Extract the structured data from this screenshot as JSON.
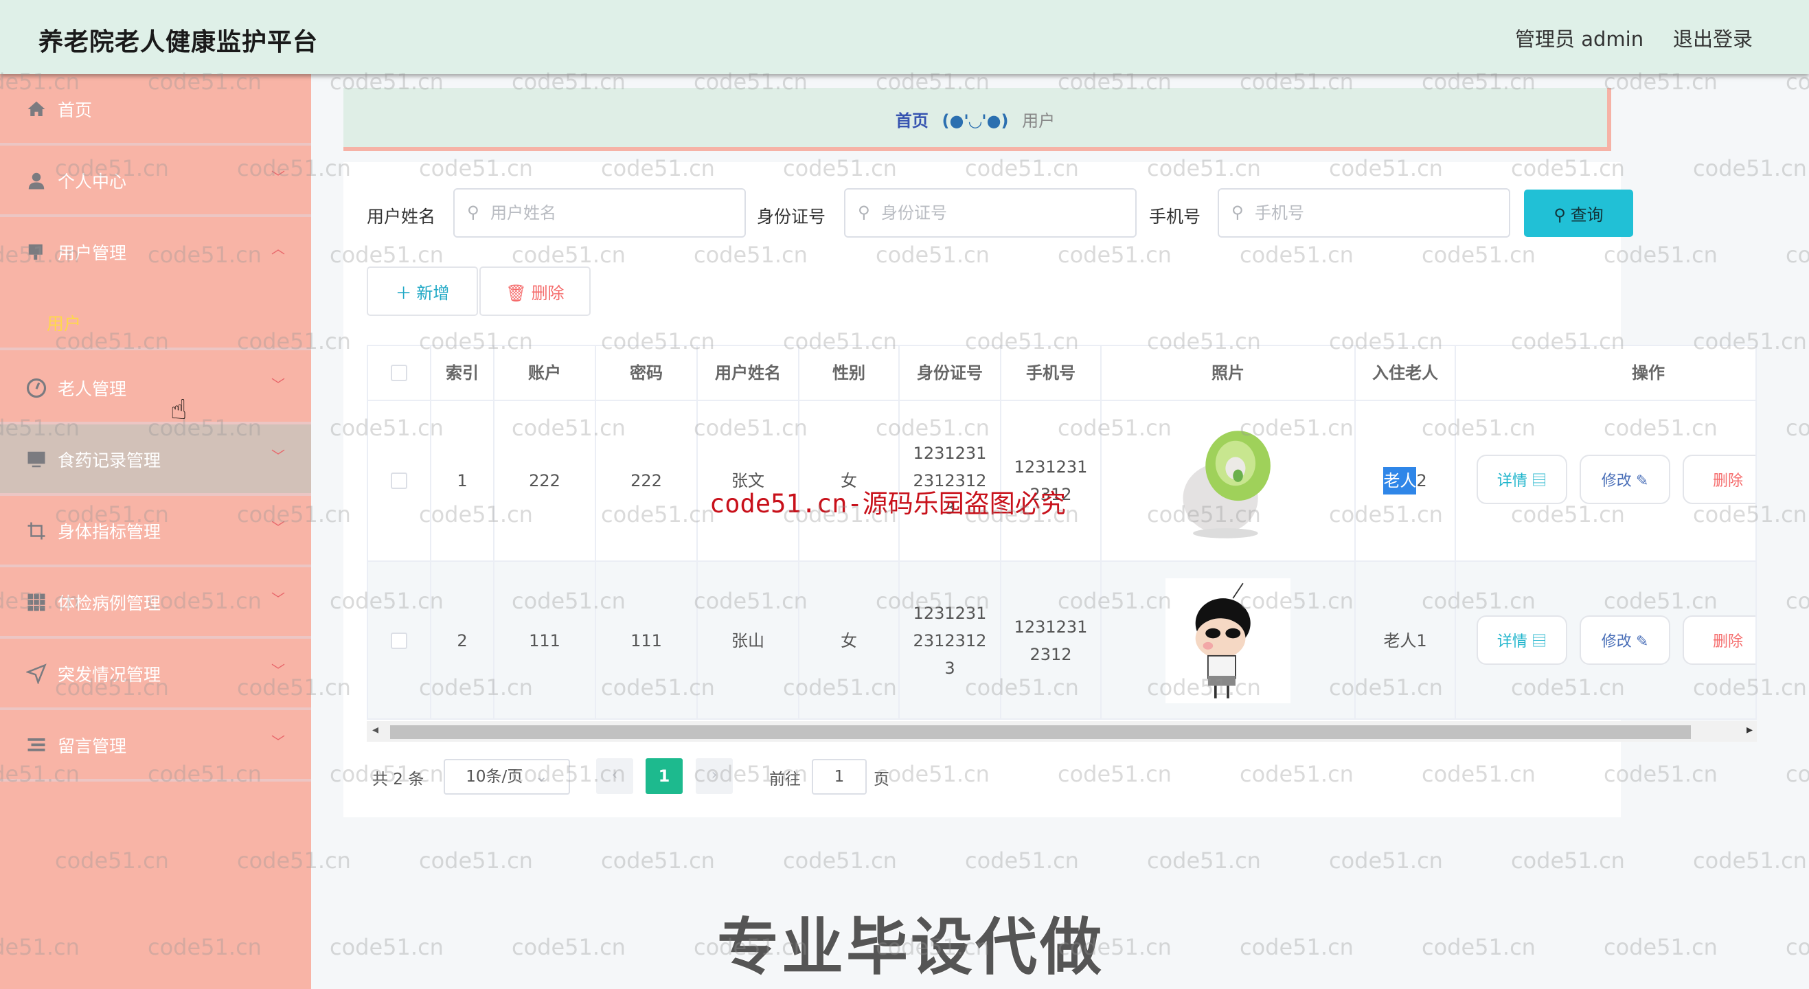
{
  "header": {
    "title": "养老院老人健康监护平台",
    "user": "管理员 admin",
    "logout": "退出登录"
  },
  "sidebar": {
    "items": [
      {
        "label": "首页",
        "icon": "home-icon",
        "arrow": ""
      },
      {
        "label": "个人中心",
        "icon": "user-icon",
        "arrow": "⌄"
      },
      {
        "label": "用户管理",
        "icon": "monitor-user-icon",
        "arrow": "⌃"
      },
      {
        "label": "老人管理",
        "icon": "dashboard-icon",
        "arrow": "⌄"
      },
      {
        "label": "食药记录管理",
        "icon": "monitor-icon",
        "arrow": "⌄"
      },
      {
        "label": "身体指标管理",
        "icon": "crop-icon",
        "arrow": "⌄"
      },
      {
        "label": "体检病例管理",
        "icon": "grid-icon",
        "arrow": "⌄"
      },
      {
        "label": "突发情况管理",
        "icon": "send-icon",
        "arrow": "⌄"
      },
      {
        "label": "留言管理",
        "icon": "list-icon",
        "arrow": "⌄"
      }
    ],
    "submenu": {
      "label": "用户"
    }
  },
  "breadcrumb": {
    "home": "首页",
    "separator": "(●'◡'●)",
    "current": "用户"
  },
  "search": {
    "fields": [
      {
        "label": "用户姓名",
        "placeholder": "用户姓名",
        "value": ""
      },
      {
        "label": "身份证号",
        "placeholder": "身份证号",
        "value": ""
      },
      {
        "label": "手机号",
        "placeholder": "手机号",
        "value": ""
      }
    ],
    "query_button": "查询"
  },
  "toolbar": {
    "add": "新增",
    "delete": "删除"
  },
  "table": {
    "headers": [
      "索引",
      "账户",
      "密码",
      "用户姓名",
      "性别",
      "身份证号",
      "手机号",
      "照片",
      "入住老人",
      "操作"
    ],
    "rows": [
      {
        "index": "1",
        "account": "222",
        "password": "222",
        "name": "张文",
        "gender": "女",
        "id_lines": [
          "1231231",
          "2312312",
          "3"
        ],
        "phone_lines": [
          "1231231",
          "2312"
        ],
        "photo": "cabbage-dog-photo",
        "elder_hl": "老人",
        "elder_rest": "2"
      },
      {
        "index": "2",
        "account": "111",
        "password": "111",
        "name": "张山",
        "gender": "女",
        "id_lines": [
          "1231231",
          "2312312",
          "3"
        ],
        "phone_lines": [
          "1231231",
          "2312"
        ],
        "photo": "cartoon-boy-photo",
        "elder_hl": "",
        "elder_rest": "老人1"
      }
    ],
    "actions": {
      "detail": "详情",
      "edit": "修改",
      "delete": "删除"
    }
  },
  "pagination": {
    "total": "共 2 条",
    "page_size": "10条/页",
    "current_page": "1",
    "goto_label": "前往",
    "goto_value": "1",
    "page_suffix": "页"
  },
  "watermarks": {
    "red": "code51.cn-源码乐园盗图必究",
    "big": "专业毕设代做",
    "tile": "code51.cn"
  },
  "colors": {
    "header_bg": "#dff0e8",
    "sidebar_bg": "#f8b4a6",
    "accent_teal": "#21c0d6",
    "pager_active": "#1dba8e",
    "danger": "#f56c6c"
  }
}
